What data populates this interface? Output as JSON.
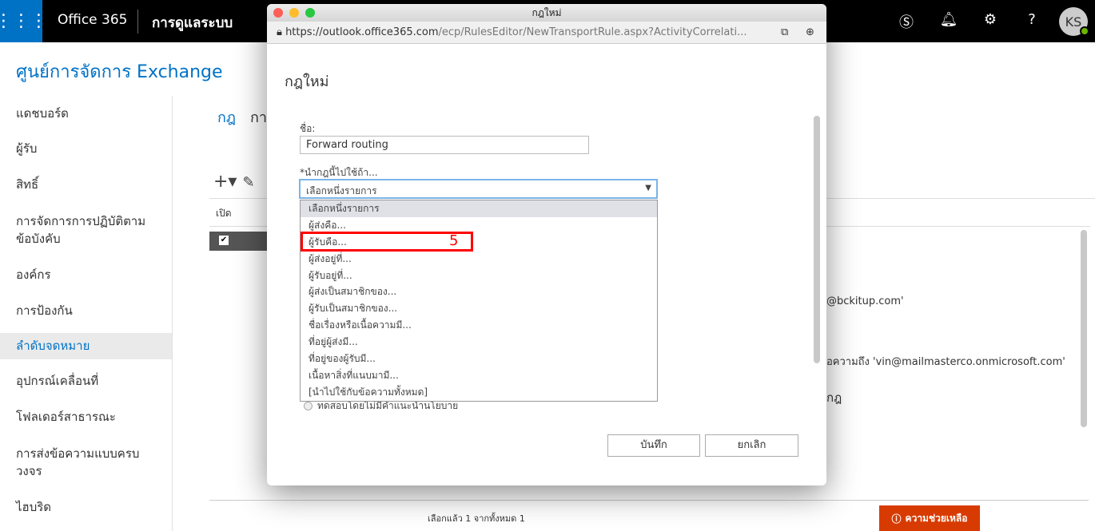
{
  "topbar": {
    "brand": "Office 365",
    "app": "การดูแลระบบ",
    "avatar": "KS",
    "icons": [
      "waffle-icon",
      "skype-icon",
      "bell-icon",
      "gear-icon",
      "help-icon"
    ]
  },
  "eac_title": "ศูนย์การจัดการ Exchange",
  "nav": {
    "items": [
      "แดชบอร์ด",
      "ผู้รับ",
      "สิทธิ์",
      "การจัดการการปฏิบัติตามข้อบังคับ",
      "องค์กร",
      "การป้องกัน",
      "ลำดับจดหมาย",
      "อุปกรณ์เคลื่อนที่",
      "โฟลเดอร์สาธารณะ",
      "การส่งข้อความแบบครบวงจร",
      "ไฮบริด"
    ],
    "active": "ลำดับจดหมาย"
  },
  "tabs": [
    "กฎ",
    "กา"
  ],
  "table": {
    "column": "เปิด"
  },
  "details": {
    "line1": "@bckitup.com'",
    "line2": "อความถึง 'vin@mailmasterco.onmicrosoft.com'",
    "heading": "กฎ"
  },
  "footer": "เลือกแล้ว 1 จากทั้งหมด 1",
  "help": "ความช่วยเหลือ",
  "dialog": {
    "window_title": "กฎใหม่",
    "url_main": "https://outlook.office365.com",
    "url_rest": "/ecp/RulesEditor/NewTransportRule.aspx?ActivityCorrelati...",
    "heading": "กฎใหม่",
    "name_label": "ชื่อ:",
    "name_value": "Forward routing",
    "apply_label": "*นำกฎนี้ไปใช้ถ้า...",
    "select_value": "เลือกหนึ่งรายการ",
    "options": [
      "เลือกหนึ่งรายการ",
      "ผู้ส่งคือ...",
      "ผู้รับคือ...",
      "ผู้ส่งอยู่ที่...",
      "ผู้รับอยู่ที่...",
      "ผู้ส่งเป็นสมาชิกของ...",
      "ผู้รับเป็นสมาชิกของ...",
      "ชื่อเรื่องหรือเนื้อความมี...",
      "ที่อยู่ผู้ส่งมี...",
      "ที่อยู่ของผู้รับมี...",
      "เนื้อหาสิ่งที่แนบมามี...",
      "[นำไปใช้กับข้อความทั้งหมด]"
    ],
    "annotation": "5",
    "radio_label": "ทดสอบโดยไม่มีคำแนะนำนโยบาย",
    "save": "บันทึก",
    "cancel": "ยกเลิก"
  }
}
